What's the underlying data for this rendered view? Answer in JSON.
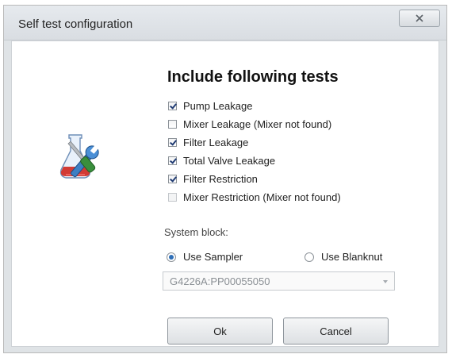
{
  "window": {
    "title": "Self test configuration",
    "close_label": "X"
  },
  "icon": "flask-wrench-icon",
  "heading": "Include following tests",
  "tests": [
    {
      "label": "Pump Leakage",
      "checked": true,
      "enabled": true
    },
    {
      "label": "Mixer Leakage (Mixer not found)",
      "checked": false,
      "enabled": true
    },
    {
      "label": "Filter Leakage",
      "checked": true,
      "enabled": true
    },
    {
      "label": "Total Valve Leakage",
      "checked": true,
      "enabled": true
    },
    {
      "label": "Filter Restriction",
      "checked": true,
      "enabled": true
    },
    {
      "label": "Mixer Restriction (Mixer not found)",
      "checked": false,
      "enabled": false
    }
  ],
  "system_block": {
    "label": "System block:",
    "options": [
      {
        "label": "Use Sampler",
        "selected": true
      },
      {
        "label": "Use Blanknut",
        "selected": false
      }
    ],
    "dropdown_value": "G4226A:PP00055050"
  },
  "buttons": {
    "ok": "Ok",
    "cancel": "Cancel"
  }
}
